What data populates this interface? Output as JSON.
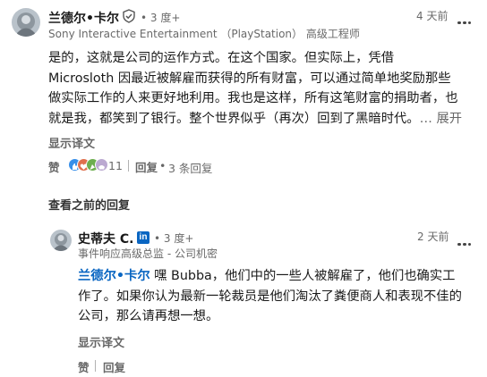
{
  "comment1": {
    "author_name": "兰德尔•卡尔",
    "degree": "• 3 度+",
    "headline": "Sony Interactive Entertainment （PlayStation） 高级工程师",
    "time": "4 天前",
    "body": {
      "line1": "是的，这就是公司的运作方式。在这个国家。但实际上，凭借",
      "line2": "Microsloth 因最近被解雇而获得的所有财富，可以通过简单地奖励那些",
      "line3": "做实际工作的人来更好地利用。我也是这样，所有这笔财富的捐助者，也",
      "line4": "就是我，都笑到了银行。整个世界似乎（再次）回到了黑暗时代。",
      "more": "… 展开"
    },
    "translate": "显示译文",
    "like": "赞",
    "reaction_count": "11",
    "reply": "回复",
    "reply_count": "3 条回复",
    "reaction_icons": [
      "like-icon",
      "heart-icon",
      "celebrate-icon",
      "support-icon"
    ]
  },
  "load_previous": "查看之前的回复",
  "reply1": {
    "author_name": "史蒂夫 C.",
    "linkedin_badge": "in",
    "degree": "• 3 度+",
    "headline": "事件响应高级总监 - 公司机密",
    "time": "2 天前",
    "mention": "兰德尔•卡尔",
    "body": {
      "line1_rest": " 嘿 Bubba，他们中的一些人被解雇了，他们也确实工",
      "line2": "作了。如果你认为最新一轮裁员是他们淘汰了粪便商人和表现不佳的",
      "line3": "公司，那么请再想一想。"
    },
    "translate": "显示译文",
    "like": "赞",
    "reply": "回复"
  },
  "colors": {
    "link_blue": "#0a66c2",
    "like_blue": "#378fe9",
    "love_red": "#df704d",
    "celebrate_green": "#6dae4f"
  }
}
